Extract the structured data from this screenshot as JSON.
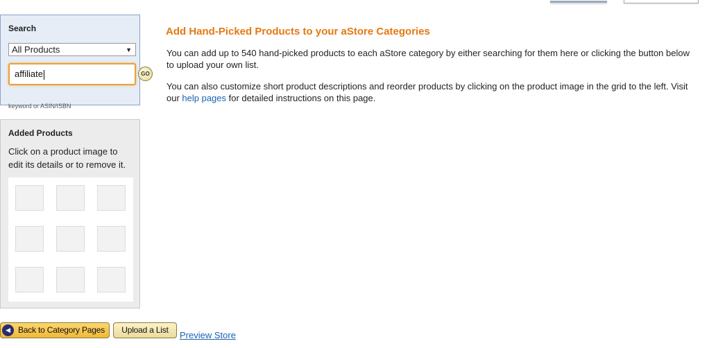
{
  "search": {
    "title": "Search",
    "category_selected": "All Products",
    "input_value": "affiliate",
    "go_label": "GO",
    "hint": "keyword or ASIN/ISBN"
  },
  "added_products": {
    "title": "Added Products",
    "description": "Click on a product image to edit its details or to remove it.",
    "slot_count": 9
  },
  "main": {
    "title": "Add Hand-Picked Products to your aStore Categories",
    "paragraph1": "You can add up to 540 hand-picked products to each aStore category by either searching for them here or clicking the button below to upload your own list.",
    "paragraph2_before": "You can also customize short product descriptions and reorder products by clicking on the product image in the grid to the left. Visit our ",
    "paragraph2_link": "help pages",
    "paragraph2_after": " for detailed instructions on this page."
  },
  "footer": {
    "back_label": "Back to Category Pages",
    "back_icon": "arrow-left-icon",
    "upload_label": "Upload a List",
    "preview_label": "Preview Store"
  },
  "colors": {
    "title_orange": "#e47911",
    "link_blue": "#1a62b0",
    "search_panel_bg": "#e6edf7",
    "button_gold": "#efb938"
  }
}
